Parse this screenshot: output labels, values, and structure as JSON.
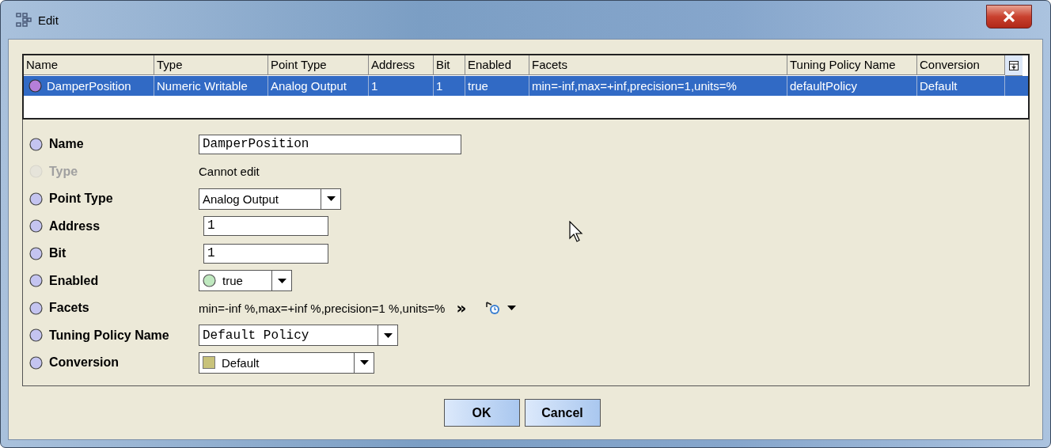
{
  "window": {
    "title": "Edit"
  },
  "table": {
    "columns": [
      "Name",
      "Type",
      "Point Type",
      "Address",
      "Bit",
      "Enabled",
      "Facets",
      "Tuning Policy Name",
      "Conversion"
    ],
    "rows": [
      {
        "selected": true,
        "cells": [
          "DamperPosition",
          "Numeric Writable",
          "Analog Output",
          "1",
          "1",
          "true",
          "min=-inf,max=+inf,precision=1,units=%",
          "defaultPolicy",
          "Default"
        ]
      }
    ]
  },
  "form": [
    {
      "kind": "text",
      "label": "Name",
      "disabled": false,
      "value": "DamperPosition"
    },
    {
      "kind": "readonly",
      "label": "Type",
      "disabled": true,
      "value": "Cannot edit"
    },
    {
      "kind": "select",
      "label": "Point Type",
      "disabled": false,
      "value": "Analog Output",
      "mono": false
    },
    {
      "kind": "text",
      "label": "Address",
      "disabled": false,
      "value": "1"
    },
    {
      "kind": "text",
      "label": "Bit",
      "disabled": false,
      "value": "1"
    },
    {
      "kind": "bool-select",
      "label": "Enabled",
      "disabled": false,
      "value": "true"
    },
    {
      "kind": "facets",
      "label": "Facets",
      "disabled": false,
      "value": "min=-inf %,max=+inf %,precision=1 %,units=%",
      "more": "»"
    },
    {
      "kind": "select",
      "label": "Tuning Policy Name",
      "disabled": false,
      "value": "Default Policy",
      "mono": true
    },
    {
      "kind": "color-select",
      "label": "Conversion",
      "disabled": false,
      "value": "Default",
      "color": "#c8c27a"
    }
  ],
  "buttons": [
    "OK",
    "Cancel"
  ]
}
